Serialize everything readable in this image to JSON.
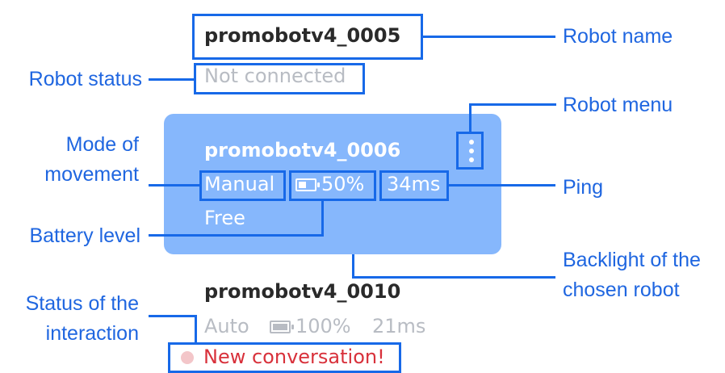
{
  "robots": [
    {
      "name": "promobotv4_0005",
      "status": "Not connected"
    },
    {
      "name": "promobotv4_0006",
      "mode": "Manual",
      "battery": "50%",
      "battery_level": 0.5,
      "ping": "34ms",
      "interaction": "Free"
    },
    {
      "name": "promobotv4_0010",
      "mode": "Auto",
      "battery": "100%",
      "battery_level": 1.0,
      "ping": "21ms",
      "interaction": "New conversation!"
    }
  ],
  "annotations": {
    "robot_name": "Robot name",
    "robot_status": "Robot status",
    "robot_menu": "Robot menu",
    "mode_line1": "Mode of",
    "mode_line2": "movement",
    "ping": "Ping",
    "battery_level": "Battery level",
    "backlight_line1": "Backlight of the",
    "backlight_line2": "chosen robot",
    "interaction_line1": "Status of the",
    "interaction_line2": "interaction"
  },
  "colors": {
    "annotation": "#1769e8",
    "selected_backlight": "#86b7fc",
    "new_conversation": "#d8313b"
  }
}
